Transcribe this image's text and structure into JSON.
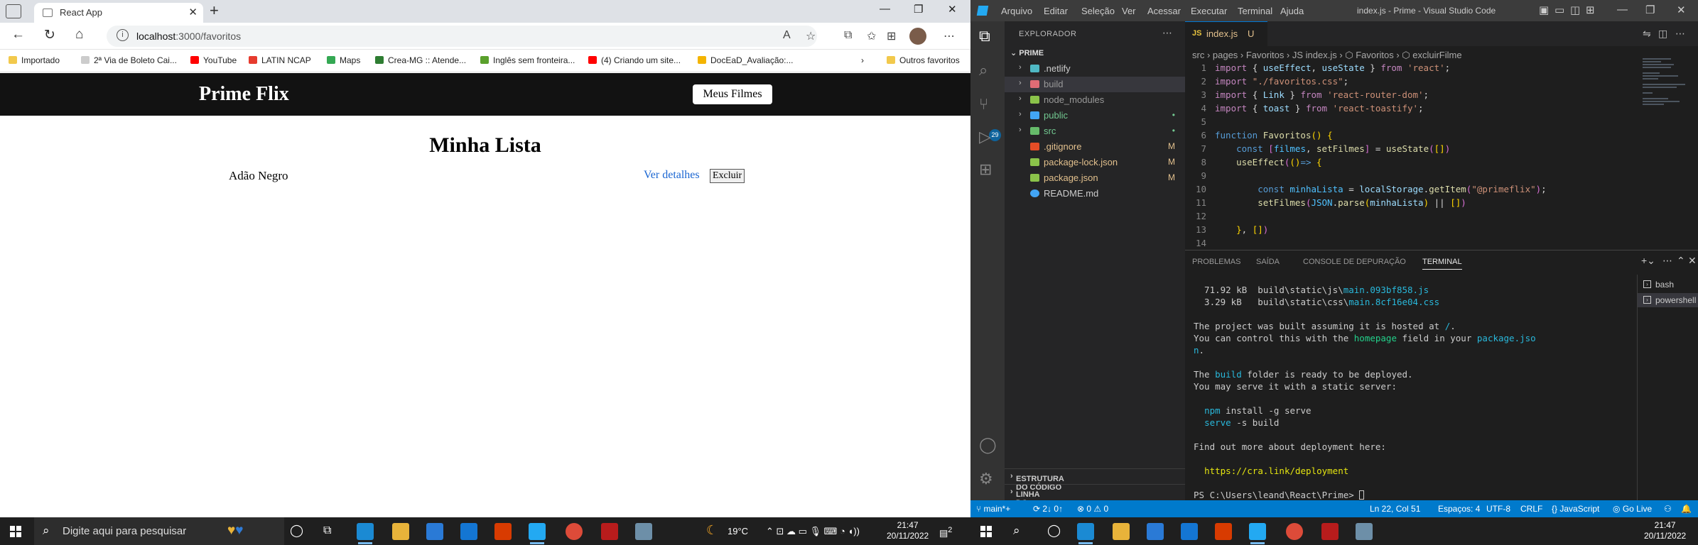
{
  "browser": {
    "tab_title": "React App",
    "url_host": "localhost",
    "url_rest": ":3000/favoritos",
    "bookmarks": [
      {
        "label": "Importado",
        "color": "#f2c94c"
      },
      {
        "label": "2ª Via de Boleto Cai...",
        "color": "#cccccc"
      },
      {
        "label": "YouTube",
        "color": "#ff0000"
      },
      {
        "label": "LATIN NCAP",
        "color": "#e63b2e"
      },
      {
        "label": "Maps",
        "color": "#34a853"
      },
      {
        "label": "Crea-MG :: Atende...",
        "color": "#2e7d32"
      },
      {
        "label": "Inglês sem fronteira...",
        "color": "#5aa02c"
      },
      {
        "label": "(4) Criando um site...",
        "color": "#ff0000"
      },
      {
        "label": "DocEaD_Avaliação:...",
        "color": "#f4b400"
      },
      {
        "label": "Outros favoritos",
        "color": "#f2c94c"
      }
    ]
  },
  "app": {
    "logo": "Prime Flix",
    "nav_button": "Meus Filmes",
    "page_title": "Minha Lista",
    "movies": [
      {
        "name": "Adão Negro",
        "details_link": "Ver detalhes",
        "delete_button": "Excluir"
      }
    ]
  },
  "vscode": {
    "menu": [
      "Arquivo",
      "Editar",
      "Seleção",
      "Ver",
      "Acessar",
      "Executar",
      "Terminal",
      "Ajuda"
    ],
    "window_title": "index.js - Prime - Visual Studio Code",
    "explorer_title": "EXPLORADOR",
    "project": "PRIME",
    "tree": [
      {
        "name": ".netlify",
        "kind": "folder",
        "status": "",
        "color": "#4fb8c4"
      },
      {
        "name": "build",
        "kind": "folder",
        "status": "",
        "color": "#e06c75"
      },
      {
        "name": "node_modules",
        "kind": "folder",
        "status": "",
        "color": "#8bc34a"
      },
      {
        "name": "public",
        "kind": "folder",
        "status": "•",
        "color": "#42a5f5"
      },
      {
        "name": "src",
        "kind": "folder",
        "status": "•",
        "color": "#66bb6a"
      },
      {
        "name": ".gitignore",
        "kind": "file",
        "status": "M",
        "color": "#e44d26"
      },
      {
        "name": "package-lock.json",
        "kind": "file",
        "status": "M",
        "color": "#8bc34a"
      },
      {
        "name": "package.json",
        "kind": "file",
        "status": "M",
        "color": "#8bc34a"
      },
      {
        "name": "README.md",
        "kind": "file",
        "status": "",
        "color": "#42a5f5"
      }
    ],
    "outline_section": "ESTRUTURA DO CÓDIGO",
    "timeline_section": "LINHA DO TEMPO",
    "scm_badge": "29",
    "editor_tab": "index.js",
    "editor_tab_status": "U",
    "breadcrumb": "src  ›  pages  ›  Favoritos  ›  JS  index.js  ›  ⬡ Favoritos  ›  ⬡ excluirFilme",
    "panel_tabs": [
      "PROBLEMAS",
      "SAÍDA",
      "CONSOLE DE DEPURAÇÃO",
      "TERMINAL"
    ],
    "shells": [
      "bash",
      "powershell"
    ],
    "statusbar": {
      "branch": "main*+",
      "sync": "⟳ 2↓ 0↑",
      "problems": "⊗ 0 ⚠ 0",
      "position": "Ln 22, Col 51",
      "spaces": "Espaços: 4",
      "encoding": "UTF-8",
      "eol": "CRLF",
      "language": "{} JavaScript",
      "golive": "Go Live"
    }
  },
  "taskbar": {
    "search_placeholder": "Digite aqui para pesquisar",
    "weather": "19°C",
    "time_left": "21:47",
    "date_left": "20/11/2022",
    "time_right": "21:47",
    "date_right": "20/11/2022",
    "notif_count": "2"
  }
}
